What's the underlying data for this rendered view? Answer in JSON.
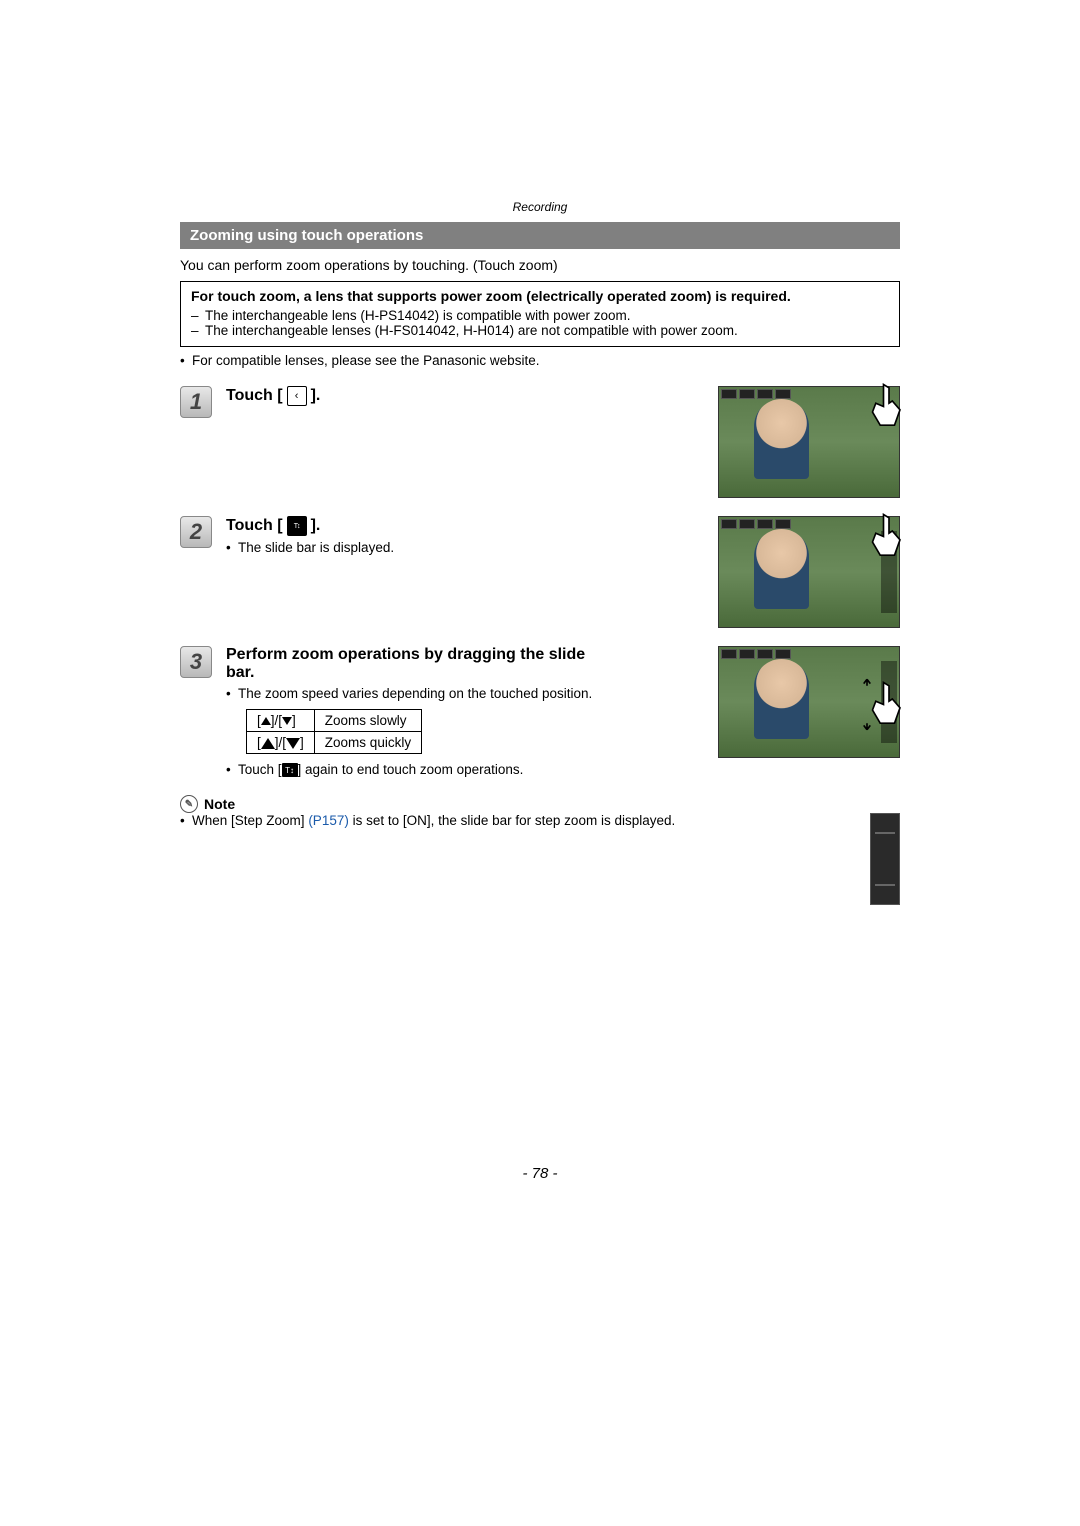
{
  "header": "Recording",
  "section_title": "Zooming using touch operations",
  "intro": "You can perform zoom operations by touching. (Touch zoom)",
  "req": {
    "main": "For touch zoom, a lens that supports power zoom (electrically operated zoom) is required.",
    "items": [
      "The interchangeable lens (H-PS14042) is compatible with power zoom.",
      "The interchangeable lenses (H-FS014042, H-H014) are not compatible with power zoom."
    ]
  },
  "compat_note": "For compatible lenses, please see the Panasonic website.",
  "steps": [
    {
      "num": "1",
      "title_prefix": "Touch [",
      "title_suffix": "].",
      "icon_dark": false,
      "icon_glyph": "‹",
      "bullets": []
    },
    {
      "num": "2",
      "title_prefix": "Touch [",
      "title_suffix": "].",
      "icon_dark": true,
      "icon_glyph": "T↕W",
      "bullets": [
        "The slide bar is displayed."
      ]
    },
    {
      "num": "3",
      "title_plain": "Perform zoom operations by dragging the slide bar.",
      "bullets": [
        "The zoom speed varies depending on the touched position."
      ]
    }
  ],
  "zoom_table": [
    {
      "desc": "Zooms slowly"
    },
    {
      "desc": "Zooms quickly"
    }
  ],
  "end_touch_prefix": "Touch [",
  "end_touch_suffix": "] again to end touch zoom operations.",
  "note": {
    "label": "Note",
    "text_a": "When [Step Zoom] ",
    "link": "(P157)",
    "text_b": " is set to [ON], the slide bar for step zoom is displayed."
  },
  "page_number": "- 78 -"
}
